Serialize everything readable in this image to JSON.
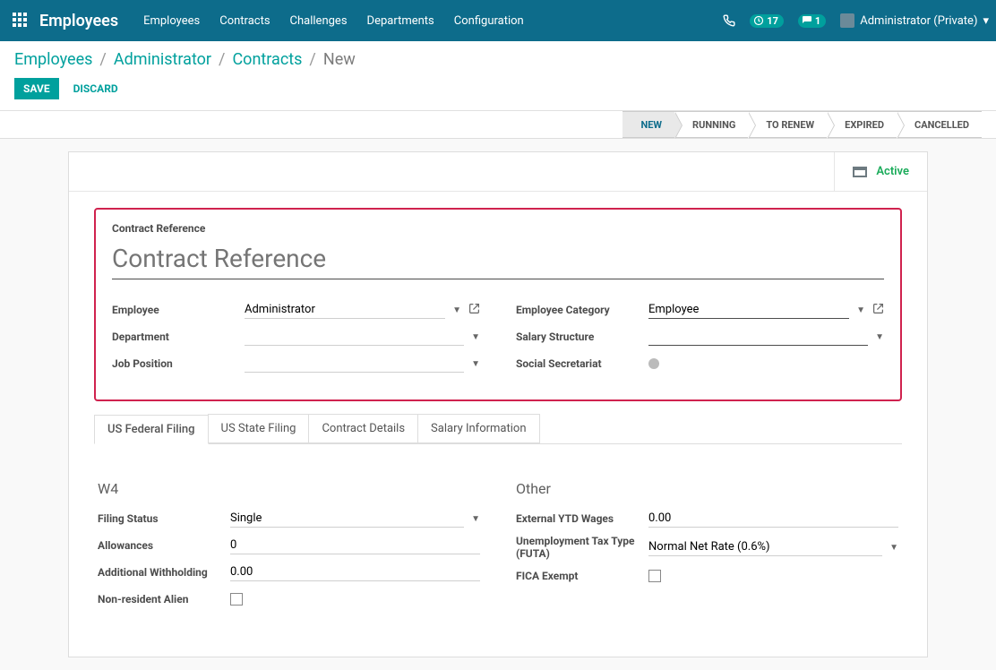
{
  "topbar": {
    "brand": "Employees",
    "nav": [
      "Employees",
      "Contracts",
      "Challenges",
      "Departments",
      "Configuration"
    ],
    "clock_badge": "17",
    "chat_badge": "1",
    "user_label": "Administrator (Private)"
  },
  "breadcrumb": {
    "items": [
      "Employees",
      "Administrator",
      "Contracts"
    ],
    "current": "New"
  },
  "actions": {
    "save": "SAVE",
    "discard": "DISCARD"
  },
  "statusbar": {
    "items": [
      "NEW",
      "RUNNING",
      "TO RENEW",
      "EXPIRED",
      "CANCELLED"
    ],
    "active_index": 0
  },
  "archive_button": "Active",
  "form": {
    "ref_label": "Contract Reference",
    "ref_placeholder": "Contract Reference",
    "left": {
      "employee_label": "Employee",
      "employee_value": "Administrator",
      "department_label": "Department",
      "department_value": "",
      "job_label": "Job Position",
      "job_value": ""
    },
    "right": {
      "category_label": "Employee Category",
      "category_value": "Employee",
      "salary_label": "Salary Structure",
      "salary_value": "",
      "social_label": "Social Secretariat"
    }
  },
  "tabs": [
    "US Federal Filing",
    "US State Filing",
    "Contract Details",
    "Salary Information"
  ],
  "tab_active_index": 0,
  "w4": {
    "heading": "W4",
    "filing_label": "Filing Status",
    "filing_value": "Single",
    "allow_label": "Allowances",
    "allow_value": "0",
    "addl_label": "Additional Withholding",
    "addl_value": "0.00",
    "nra_label": "Non-resident Alien"
  },
  "other": {
    "heading": "Other",
    "ytd_label": "External YTD Wages",
    "ytd_value": "0.00",
    "futa_label": "Unemployment Tax Type (FUTA)",
    "futa_value": "Normal Net Rate (0.6%)",
    "fica_label": "FICA Exempt"
  }
}
